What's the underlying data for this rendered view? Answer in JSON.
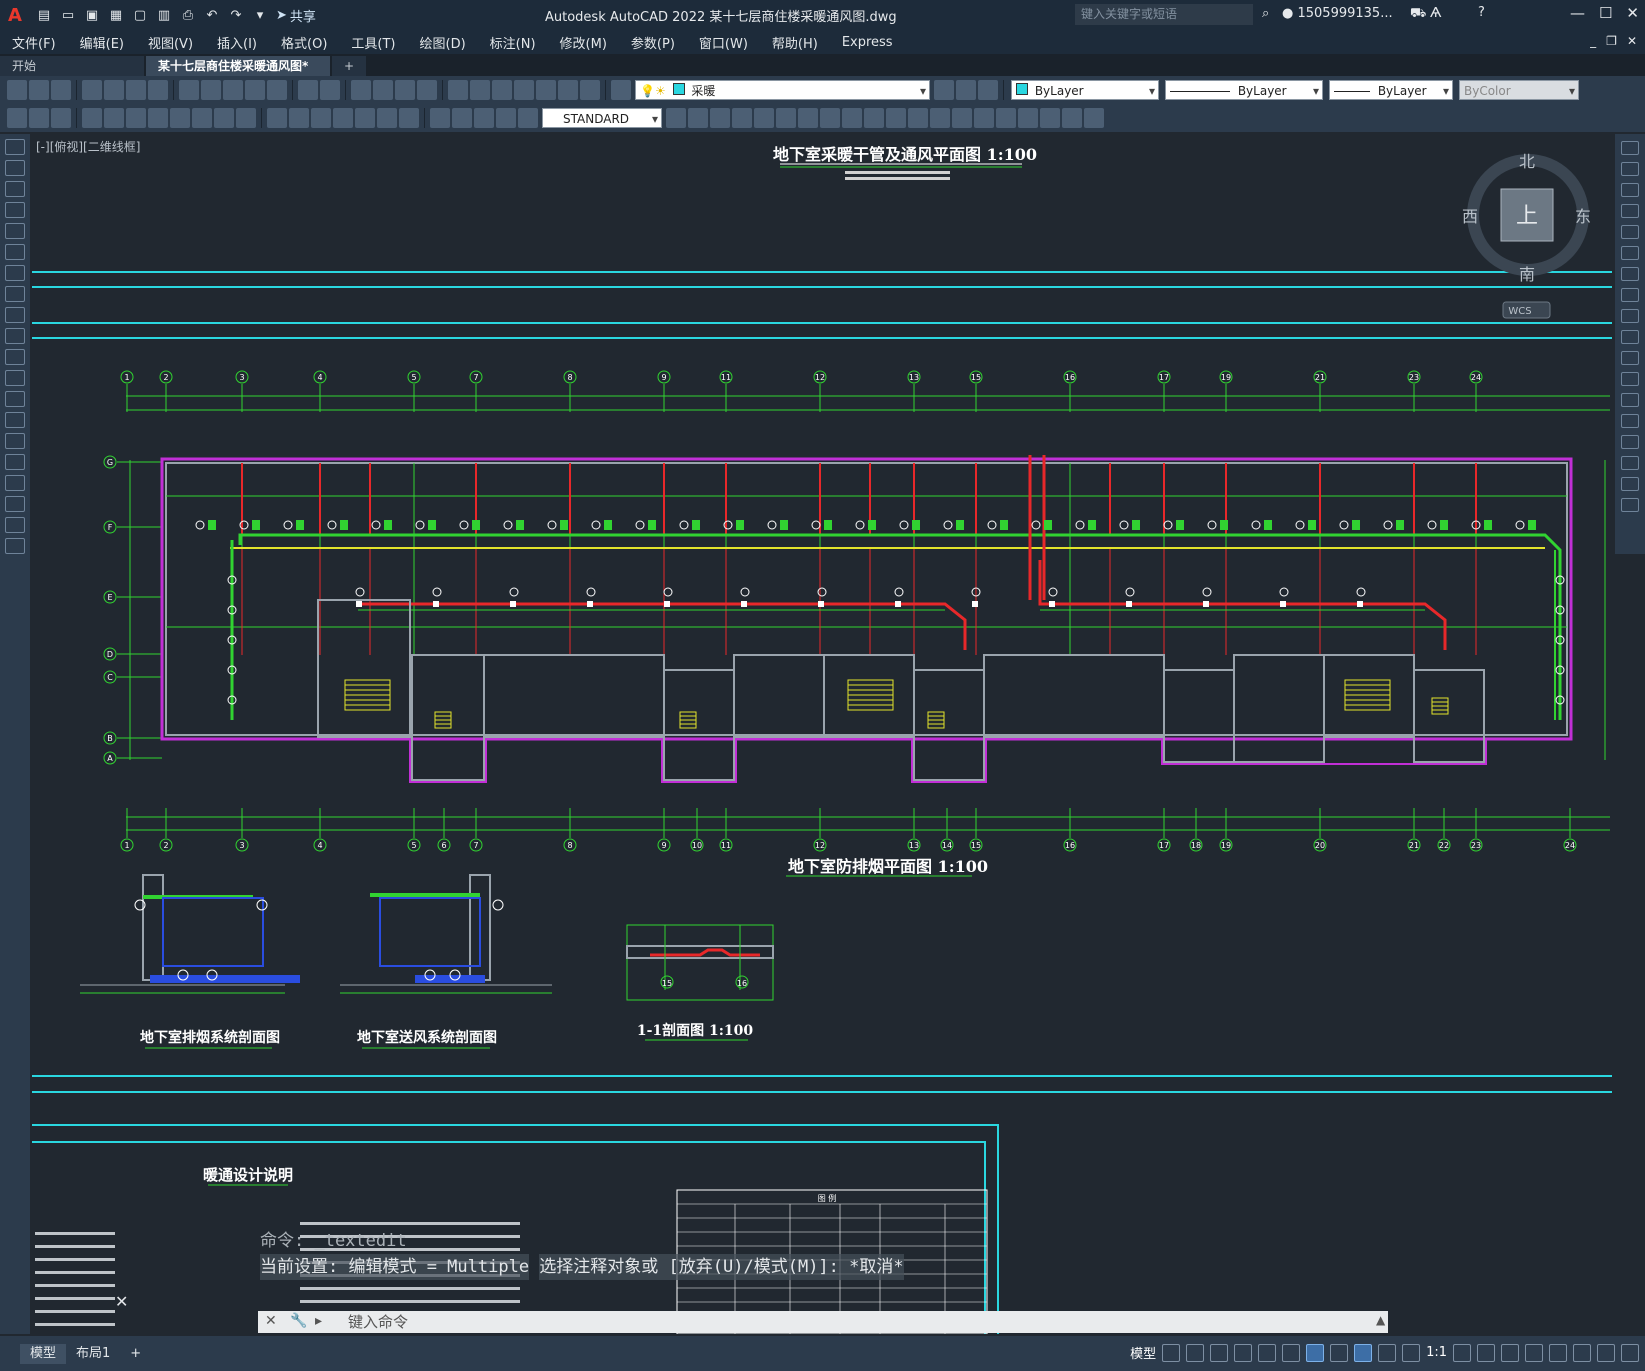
{
  "titlebar": {
    "app_title": "Autodesk AutoCAD 2022    某十七层商住楼采暖通风图.dwg",
    "share_label": "共享",
    "search_placeholder": "键入关键字或短语",
    "user_name": "1505999135...",
    "logo_letter": "A"
  },
  "menu": [
    "文件(F)",
    "编辑(E)",
    "视图(V)",
    "插入(I)",
    "格式(O)",
    "工具(T)",
    "绘图(D)",
    "标注(N)",
    "修改(M)",
    "参数(P)",
    "窗口(W)",
    "帮助(H)",
    "Express"
  ],
  "tabs": [
    {
      "label": "开始",
      "active": false
    },
    {
      "label": "某十七层商住楼采暖通风图*",
      "active": true
    }
  ],
  "toolbar": {
    "layer_name": "采暖",
    "color_value": "ByLayer",
    "linetype_value": "ByLayer",
    "lineweight_value": "ByLayer",
    "plotstyle_value": "ByColor",
    "textstyle_value": "STANDARD"
  },
  "viewport": {
    "label": "[-][俯视][二维线框]"
  },
  "viewcube": {
    "north": "北",
    "south": "南",
    "east": "东",
    "west": "西",
    "top": "上",
    "wcs": "WCS"
  },
  "drawing": {
    "plan_title": "地下室采暖干管及通风平面图  1:100",
    "smoke_title": "地下室防排烟平面图  1:100",
    "section_exhaust_title": "地下室排烟系统剖面图",
    "section_supply_title": "地下室送风系统剖面图",
    "section_11_title": "1-1剖面图  1:100",
    "notes_title": "暖通设计说明",
    "legend_title": "图 例",
    "top_axes": [
      "1",
      "2",
      "3",
      "4",
      "5",
      "7",
      "8",
      "9",
      "11",
      "12",
      "13",
      "15",
      "16",
      "17",
      "19",
      "21",
      "23",
      "24"
    ],
    "bottom_axes": [
      "1",
      "2",
      "3",
      "4",
      "5",
      "6",
      "7",
      "8",
      "9",
      "10",
      "11",
      "12",
      "13",
      "14",
      "15",
      "16",
      "17",
      "18",
      "19",
      "20",
      "21",
      "22",
      "23",
      "24"
    ],
    "row_axes": [
      "G",
      "F",
      "E",
      "D",
      "C",
      "B",
      "A"
    ],
    "section_marks": [
      "15",
      "16"
    ]
  },
  "command": {
    "line1": "命令:  _textedit",
    "line2": "当前设置: 编辑模式 = Multiple",
    "line3": "选择注释对象或 [放弃(U)/模式(M)]: *取消*",
    "input_placeholder": "键入命令"
  },
  "status": {
    "model_tab": "模型",
    "layout_tab": "布局1",
    "add_tab": "+",
    "model_label": "模型",
    "scale": "1:1"
  },
  "colors": {
    "canvas": "#212830",
    "cyan": "#2ad7e0",
    "green": "#31d331",
    "red": "#e8282a",
    "magenta": "#c12fd6",
    "yellow": "#e3e32c",
    "wall": "#9aa4ad"
  }
}
